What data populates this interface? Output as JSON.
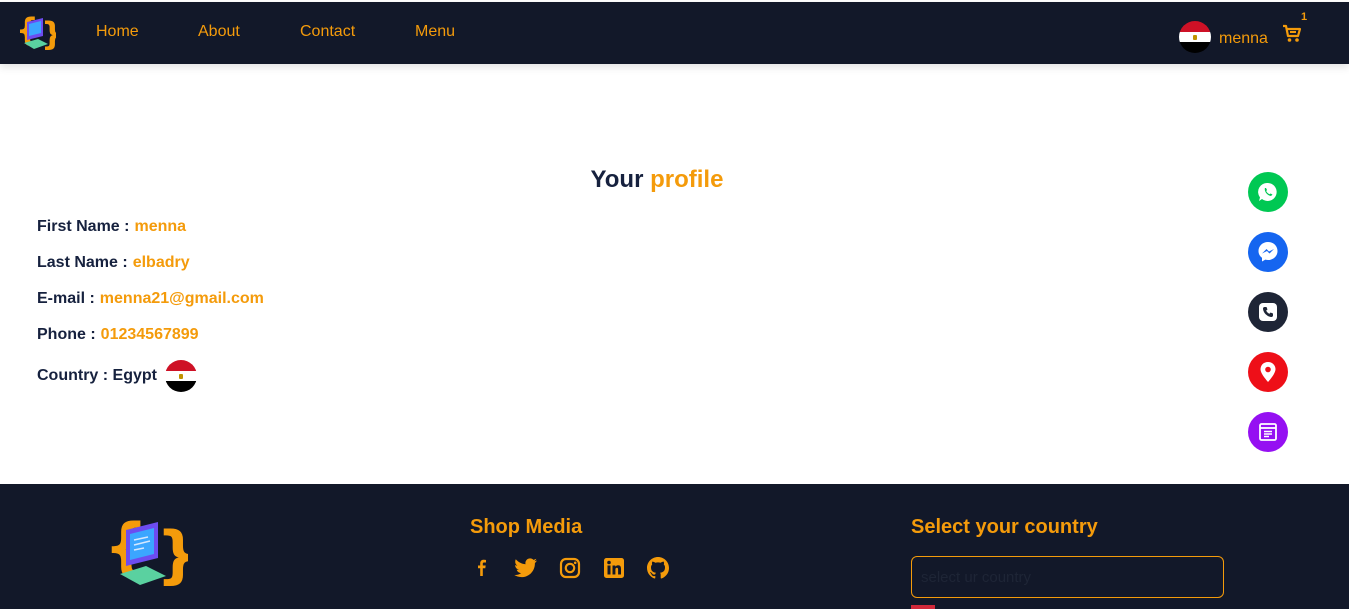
{
  "nav": {
    "links": [
      "Home",
      "About",
      "Contact",
      "Menu"
    ],
    "username": "menna",
    "cart_count": "1"
  },
  "profile": {
    "title_part1": "Your",
    "title_part2": "profile",
    "first_name_label": "First Name :",
    "first_name": "menna",
    "last_name_label": "Last Name :",
    "last_name": "elbadry",
    "email_label": "E-mail :",
    "email": "menna21@gmail.com",
    "phone_label": "Phone :",
    "phone": "01234567899",
    "country_label": "Country : Egypt"
  },
  "floating_buttons": [
    {
      "icon": "whatsapp-icon",
      "color": "#00c853"
    },
    {
      "icon": "messenger-icon",
      "color": "#1565f0"
    },
    {
      "icon": "phone-icon",
      "color": "#1e2536"
    },
    {
      "icon": "location-pin-icon",
      "color": "#ee0f18"
    },
    {
      "icon": "menu-board-icon",
      "color": "#9510f2"
    }
  ],
  "footer": {
    "shop_media_title": "Shop Media",
    "social_icons": [
      "facebook-icon",
      "twitter-icon",
      "instagram-icon",
      "linkedin-icon",
      "github-icon"
    ],
    "country_title": "Select your country",
    "country_placeholder": "select ur country"
  },
  "colors": {
    "accent": "#f49b0b",
    "navy": "#121829",
    "text_dark": "#16213e"
  }
}
